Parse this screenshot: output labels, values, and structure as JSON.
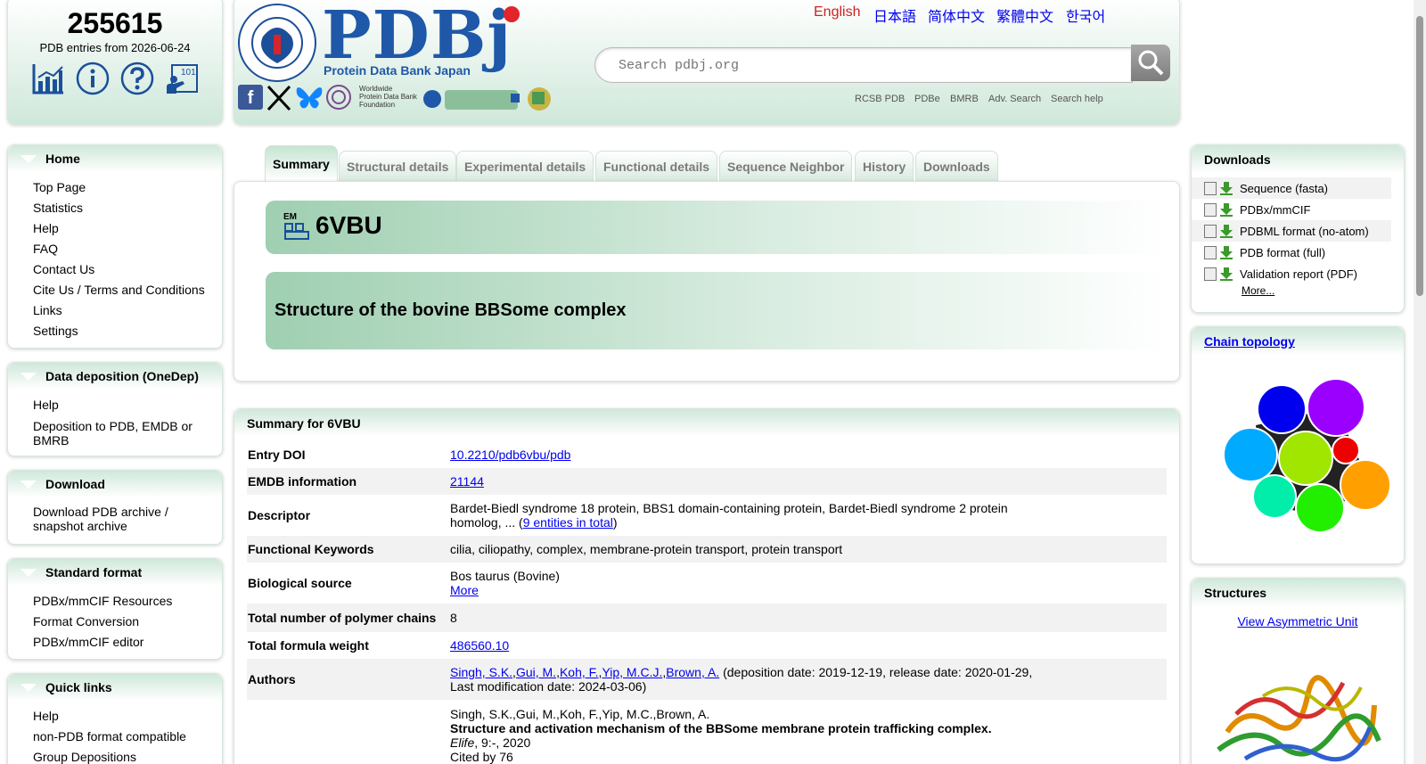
{
  "stats": {
    "count": "255615",
    "subtitle": "PDB entries from 2026-06-24",
    "icons": [
      "statistics-icon",
      "info-icon",
      "help-icon",
      "tutorial-icon"
    ]
  },
  "header": {
    "logo_text": "PDBj",
    "logo_subtitle": "Protein Data Bank Japan",
    "languages": [
      "English",
      "日本語",
      "简体中文",
      "繁體中文",
      "한국어"
    ],
    "active_language": "English",
    "search_placeholder": "Search pdbj.org",
    "wwpdb_foundation": [
      "Worldwide",
      "Protein Data Bank",
      "Foundation"
    ],
    "links": [
      "RCSB PDB",
      "PDBe",
      "BMRB",
      "Adv. Search",
      "Search help"
    ]
  },
  "sidebar": {
    "home": {
      "title": "Home",
      "items": [
        "Top Page",
        "Statistics",
        "Help",
        "FAQ",
        "Contact Us",
        "Cite Us / Terms and Conditions",
        "Links",
        "Settings"
      ]
    },
    "deposition": {
      "title": "Data deposition (OneDep)",
      "items": [
        "Help",
        "Deposition to PDB, EMDB or BMRB"
      ]
    },
    "download": {
      "title": "Download",
      "items": [
        "Download PDB archive / snapshot archive"
      ]
    },
    "standard": {
      "title": "Standard format",
      "items": [
        "PDBx/mmCIF Resources",
        "Format Conversion",
        "PDBx/mmCIF editor"
      ]
    },
    "quick": {
      "title": "Quick links",
      "items": [
        "Help",
        "non-PDB format compatible",
        "Group Depositions"
      ]
    }
  },
  "tabs": [
    "Summary",
    "Structural details",
    "Experimental details",
    "Functional details",
    "Sequence Neighbor",
    "History",
    "Downloads"
  ],
  "entry": {
    "method_badge": "EM",
    "id": "6VBU",
    "title": "Structure of the bovine BBSome complex"
  },
  "summary": {
    "header": "Summary for 6VBU",
    "rows": {
      "doi_label": "Entry DOI",
      "doi_value": "10.2210/pdb6vbu/pdb",
      "emdb_label": "EMDB information",
      "emdb_value": "21144",
      "descriptor_label": "Descriptor",
      "descriptor_value": "Bardet-Biedl syndrome 18 protein, BBS1 domain-containing protein, Bardet-Biedl syndrome 2 protein homolog, ... (",
      "descriptor_link": "9 entities in total",
      "descriptor_close": ")",
      "keywords_label": "Functional Keywords",
      "keywords_value": "cilia, ciliopathy, complex, membrane-protein transport, protein transport",
      "source_label": "Biological source",
      "source_value": "Bos taurus (Bovine)",
      "source_more": "More",
      "chains_label": "Total number of polymer chains",
      "chains_value": "8",
      "weight_label": "Total formula weight",
      "weight_value": "486560.10",
      "authors_label": "Authors",
      "authors_links": [
        "Singh, S.K.",
        "Gui, M.",
        "Koh, F.",
        "Yip, M.C.J.",
        "Brown, A."
      ],
      "authors_dates": "(deposition date: 2019-12-19, release date: 2020-01-29, Last modification date: 2024-03-06)",
      "cite_authors": "Singh, S.K.,Gui, M.,Koh, F.,Yip, M.C.,Brown, A.",
      "cite_title": "Structure and activation mechanism of the BBSome membrane protein trafficking complex.",
      "cite_journal": "Elife",
      "cite_journal_rest": ", 9:-, 2020",
      "cite_count": "Cited by 76"
    }
  },
  "right": {
    "downloads": {
      "title": "Downloads",
      "items": [
        "Sequence (fasta)",
        "PDBx/mmCIF",
        "PDBML format (no-atom)",
        "PDB format (full)",
        "Validation report (PDF)"
      ],
      "more": "More..."
    },
    "topology": {
      "title": "Chain topology"
    },
    "structures": {
      "title": "Structures",
      "link": "View Asymmetric Unit"
    }
  },
  "colors": {
    "accent_green": "#9fcfb1",
    "active_language": "#cc2222",
    "link": "#0000ee"
  }
}
